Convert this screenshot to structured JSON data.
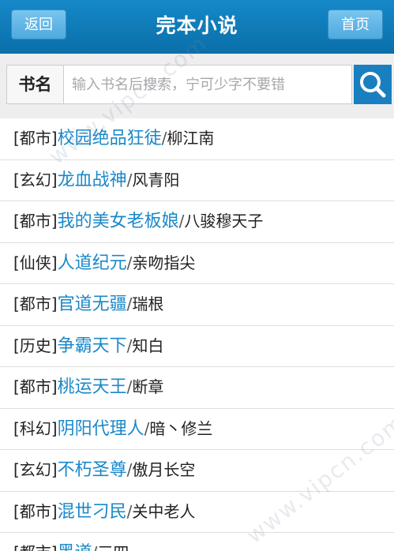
{
  "header": {
    "back_label": "返回",
    "title": "完本小说",
    "home_label": "首页"
  },
  "search": {
    "label": "书名",
    "placeholder": "输入书名后搜索，宁可少字不要错",
    "value": ""
  },
  "colors": {
    "header_bg": "#0c79b6",
    "link": "#1a88c9",
    "search_button": "#1a7fc1"
  },
  "books": [
    {
      "category": "[都市]",
      "title": "校园绝品狂徒",
      "sep": "/",
      "author": "柳江南"
    },
    {
      "category": "[玄幻]",
      "title": "龙血战神",
      "sep": "/",
      "author": "风青阳"
    },
    {
      "category": "[都市]",
      "title": "我的美女老板娘",
      "sep": "/",
      "author": "八骏穆天子"
    },
    {
      "category": "[仙侠]",
      "title": "人道纪元",
      "sep": "/",
      "author": "亲吻指尖"
    },
    {
      "category": "[都市]",
      "title": "官道无疆",
      "sep": "/",
      "author": "瑞根"
    },
    {
      "category": "[历史]",
      "title": "争霸天下",
      "sep": "/",
      "author": "知白"
    },
    {
      "category": "[都市]",
      "title": "桃运天王",
      "sep": "/",
      "author": "断章"
    },
    {
      "category": "[科幻]",
      "title": "阴阳代理人",
      "sep": "/",
      "author": "暗丶修兰"
    },
    {
      "category": "[玄幻]",
      "title": "不朽圣尊",
      "sep": "/",
      "author": "傲月长空"
    },
    {
      "category": "[都市]",
      "title": "混世刁民",
      "sep": "/",
      "author": "关中老人"
    },
    {
      "category": "[都市]",
      "title": "黑道",
      "sep": "/",
      "author": "三四"
    }
  ],
  "watermark": {
    "text": "www.vipcn.com",
    "icon": "vipcn-logo-icon"
  }
}
